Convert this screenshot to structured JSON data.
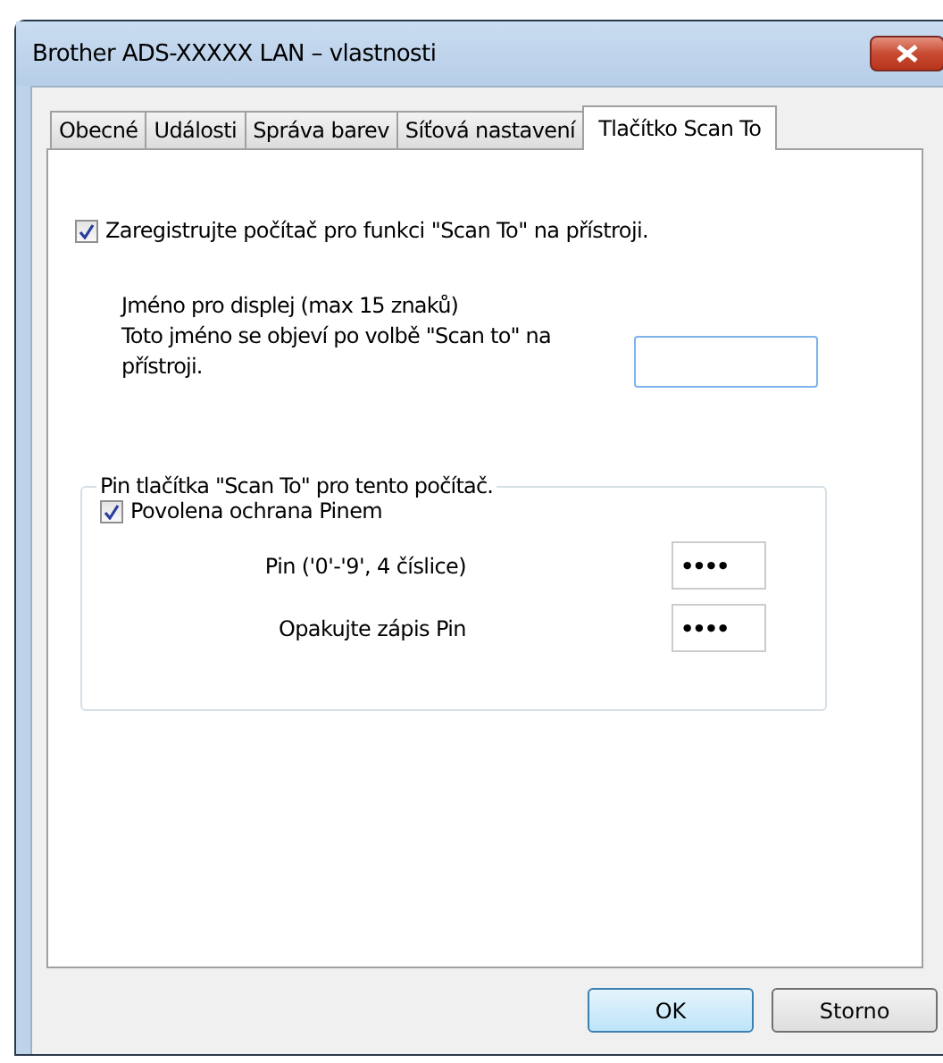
{
  "window": {
    "title": "Brother ADS-XXXXX LAN – vlastnosti"
  },
  "tabs": [
    {
      "label": "Obecné",
      "selected": false
    },
    {
      "label": "Události",
      "selected": false
    },
    {
      "label": "Správa barev",
      "selected": false
    },
    {
      "label": "Síťová nastavení",
      "selected": false
    },
    {
      "label": "Tlačítko Scan To",
      "selected": true
    }
  ],
  "register": {
    "label": "Zaregistrujte počítač pro funkci \"Scan To\" na přístroji.",
    "checked": true
  },
  "display_name": {
    "label_lines": [
      "Jméno pro displej (max 15 znaků)",
      "Toto jméno se objeví po volbě \"Scan to\" na",
      "přístroji."
    ]
  },
  "pin_group": {
    "legend": "Pin tlačítka \"Scan To\" pro tento počítač.",
    "protect": {
      "label": "Povolena ochrana Pinem",
      "checked": true
    },
    "fields": [
      {
        "label": "Pin ('0'-'9', 4 číslice)",
        "value": "••••"
      },
      {
        "label": "Opakujte zápis Pin",
        "value": "••••"
      }
    ]
  },
  "buttons": [
    {
      "label": "OK",
      "default": true
    },
    {
      "label": "Storno",
      "default": false
    }
  ]
}
